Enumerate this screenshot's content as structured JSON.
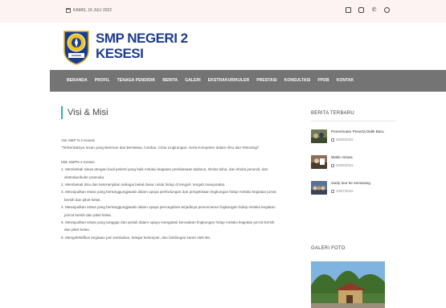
{
  "topbar": {
    "date": "KAMIS, 16 JULI 2022",
    "social_icons": [
      "document-icon",
      "instagram-icon",
      "phone-icon",
      "whatsapp-icon"
    ]
  },
  "brand": {
    "school_name_line1": "SMP NEGERI 2",
    "school_name_line2": "KESESI",
    "logo_text": "SMP NEGERI 2 KESESI"
  },
  "nav": {
    "items": [
      "BERANDA",
      "PROFIL",
      "TENAGA PENDIDIK",
      "BERITA",
      "GALERI",
      "EKSTRAKURIKULER",
      "PRESTASI",
      "KONSULTASI",
      "PPDB",
      "KONTAK"
    ]
  },
  "page": {
    "title": "Visi & Misi",
    "visi_heading": "Visi SMP N 2 Kesesi",
    "visi_text": "\"Terbentuknya Insan yang Beriman dan Bertakwa, Cerdas, Cinta Lingkungan, serta Kompeten dalam Ilmu dan Teknologi\"",
    "misi_heading": "Misi SMPN 2 Kesesi",
    "misi": [
      "1. Membekali siswa dengan budi pekerti yang baik melalui kegiatan pembiasaan tadarus, sholat duha, dan sholat jama'ah, dan",
      "ekstrakurikuler pramuka.",
      "2. Membekali ilmu dan keterampilan sebagai bekal dasar untuk hidup di tengah- tengah masyarakat.",
      "3. Mewujudkan siswa yang bertanggungjawab dalam upaya perlindungan dan pengelolaan lingkungan hidup melalui kegiatan jumat",
      "bersih dan piket kelas.",
      "4. Mewujudkan siswa yang bertanggungjawab dalam upaya pencegahan terjadinya pencemaran lingkungan hidup melalui kegiatan",
      "jum'at bersih dan piket kelas.",
      "5. Mewujudkan siswa yang tanggap dan peduli dalam upaya mengatasi kerusakan lingkungan hidup melalui kegiatan jum'at bersih",
      "dan piket kelas.",
      "6. Mengefektifkan kegiatan jam tambahan, belajar kelompok, dan bimbingan karier oleh BK."
    ]
  },
  "sidebar": {
    "news_title": "BERITA TERBARU",
    "posts": [
      {
        "title": "Penerimaan Peserta Didik Baru",
        "date": "25/06/2022"
      },
      {
        "title": "Wakin Siswa",
        "date": "20/06/2021"
      },
      {
        "title": "study tour ke semarang",
        "date": "10/07/2022"
      }
    ],
    "gallery_title": "GALERI FOTO"
  },
  "colors": {
    "brand_blue": "#1f3d8e",
    "nav_bg": "#747474",
    "accent": "#2db39a",
    "topbar_bg": "#fdf3f3"
  }
}
